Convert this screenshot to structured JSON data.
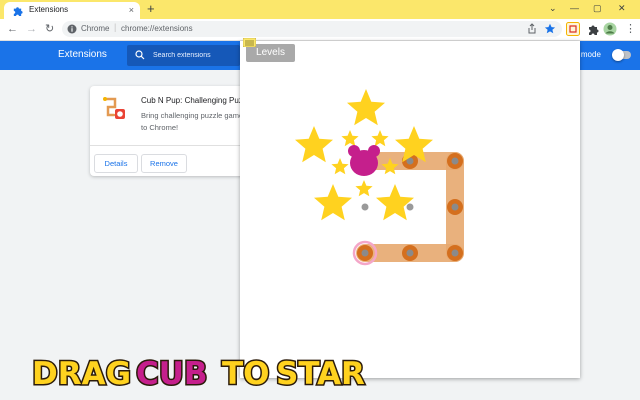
{
  "browser": {
    "tab_title": "Extensions",
    "tab_close": "×",
    "new_tab": "+",
    "url_prefix": "Chrome",
    "url_separator": "|",
    "url": "chrome://extensions",
    "window_controls": [
      "⌄",
      "—",
      "▢",
      "✕"
    ]
  },
  "extensions_page": {
    "title": "Extensions",
    "search_placeholder": "Search extensions",
    "developer_mode_label": "r mode",
    "developer_mode_on": false,
    "card": {
      "name": "Cub N Pup: Challenging Puzzle",
      "description": "Bring challenging puzzle game to Chrome!",
      "details_button": "Details",
      "remove_button": "Remove"
    }
  },
  "popup": {
    "levels_button": "Levels"
  },
  "banner": {
    "words": [
      {
        "text": "DRAG",
        "color": "#ffd21f"
      },
      {
        "text": "CUB",
        "color": "#c51f8c"
      },
      {
        "text": "TO",
        "color": "#ffd21f"
      },
      {
        "text": "STAR",
        "color": "#ffd21f"
      }
    ]
  },
  "colors": {
    "tab_strip": "#fbe76b",
    "header_blue": "#1a73e8",
    "star": "#ffd21f",
    "cub": "#c51f8c",
    "path": "#e7a86f",
    "node": "#d46f1e"
  },
  "icons": [
    "puzzle-icon",
    "back-icon",
    "forward-icon",
    "reload-icon",
    "info-icon",
    "share-icon",
    "bookmark-star-icon",
    "extension-puzzle-icon",
    "profile-avatar-icon",
    "menu-icon",
    "search-icon"
  ]
}
